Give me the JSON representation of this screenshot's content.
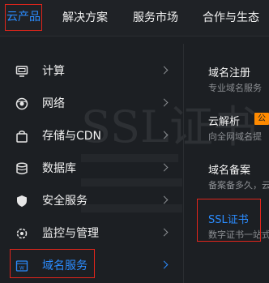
{
  "nav": {
    "tabs": [
      {
        "label": "云产品",
        "active": true
      },
      {
        "label": "解决方案"
      },
      {
        "label": "服务市场"
      },
      {
        "label": "合作与生态"
      }
    ]
  },
  "watermark": "SSL证书",
  "menu": {
    "items": [
      {
        "label": "计算",
        "icon": "monitor-icon"
      },
      {
        "label": "网络",
        "icon": "globe-icon"
      },
      {
        "label": "存储与CDN",
        "icon": "bag-icon"
      },
      {
        "label": "数据库",
        "icon": "database-icon"
      },
      {
        "label": "安全服务",
        "icon": "shield-icon"
      },
      {
        "label": "监控与管理",
        "icon": "monitor-settings-icon"
      },
      {
        "label": "域名服务",
        "icon": "domain-icon",
        "selected": true
      }
    ]
  },
  "panel": {
    "items": [
      {
        "title": "域名注册",
        "desc": "专业域名服务"
      },
      {
        "title": "云解析",
        "badge": "公",
        "desc": "向全网域名提"
      },
      {
        "title": "域名备案",
        "desc": "备案备多久，云"
      },
      {
        "title": "SSL证书",
        "desc": "数字证书一站式"
      }
    ]
  },
  "colors": {
    "accent": "#2b8cff",
    "highlight_box": "#e1251b",
    "badge": "#ff8a00",
    "background": "#1c1f23"
  }
}
